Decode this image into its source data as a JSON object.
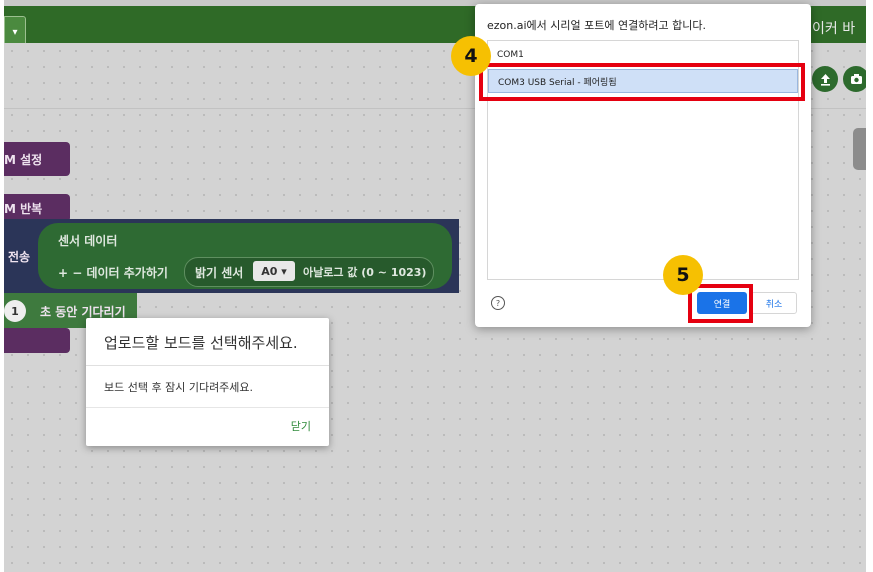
{
  "app": {
    "top_right_text": "이커 바",
    "dropdown_glyph": "▾"
  },
  "toolbar": {
    "upload_icon": "upload-icon",
    "camera_icon": "camera-icon"
  },
  "blocks": {
    "setup": "M 설정",
    "repeat": "M 반복",
    "send": "전송",
    "sensor_data": "센서 데이터",
    "add_data": "+ − 데이터 추가하기",
    "light_sensor": "밝기 센서",
    "pin": "A0 ▾",
    "analog_value": "아날로그 값 (0 ~ 1023)",
    "wait_num": "1",
    "wait_label": "초 동안 기다리기"
  },
  "upload_modal": {
    "title": "업로드할 보드를 선택해주세요.",
    "message": "보드 선택 후 잠시 기다려주세요.",
    "close": "닫기"
  },
  "serial_dialog": {
    "title": "ezon.ai에서 시리얼 포트에 연결하려고 합니다.",
    "ports": [
      "COM1",
      "COM3 USB Serial - 페어링됨"
    ],
    "selected_index": 1,
    "help": "?",
    "connect": "연결",
    "cancel": "취소"
  },
  "annotations": {
    "step4": "4",
    "step5": "5",
    "highlight_color": "#e50010",
    "badge_color": "#f6c002"
  }
}
